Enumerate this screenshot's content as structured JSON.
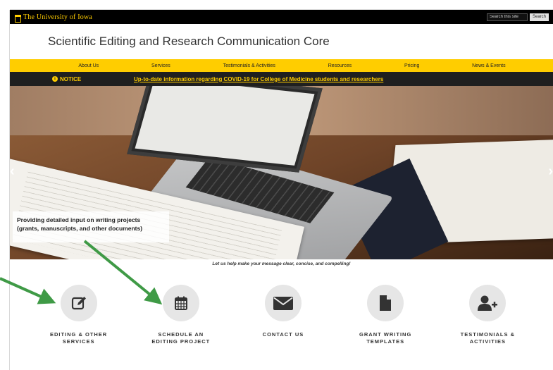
{
  "header": {
    "university_name": "The University of Iowa",
    "search_placeholder": "Search this site",
    "search_button": "Search"
  },
  "site": {
    "title": "Scientific Editing and Research Communication Core"
  },
  "nav": {
    "items": [
      "About Us",
      "Services",
      "Testimonials & Activities",
      "Resources",
      "Pricing",
      "News & Events"
    ]
  },
  "notice": {
    "label": "NOTICE",
    "link_text": "Up-to-date information regarding COVID-19 for College of Medicine students and researchers"
  },
  "hero": {
    "caption_line1": "Providing detailed input on writing projects",
    "caption_line2": "(grants, manuscripts, and other documents)",
    "prev_label": "‹",
    "next_label": "›"
  },
  "tagline": "Let us help make your message clear, concise, and compelling!",
  "cards": [
    {
      "label": "EDITING & OTHER SERVICES",
      "icon": "edit-icon"
    },
    {
      "label": "SCHEDULE AN EDITING PROJECT",
      "icon": "calendar-icon"
    },
    {
      "label": "CONTACT US",
      "icon": "envelope-icon"
    },
    {
      "label": "GRANT WRITING TEMPLATES",
      "icon": "document-icon"
    },
    {
      "label": "TESTIMONIALS & ACTIVITIES",
      "icon": "add-user-icon"
    }
  ],
  "colors": {
    "gold": "#FFCD00",
    "black": "#000000",
    "annotation_green": "#3f9a46",
    "icon_bg": "#e6e6e6"
  }
}
